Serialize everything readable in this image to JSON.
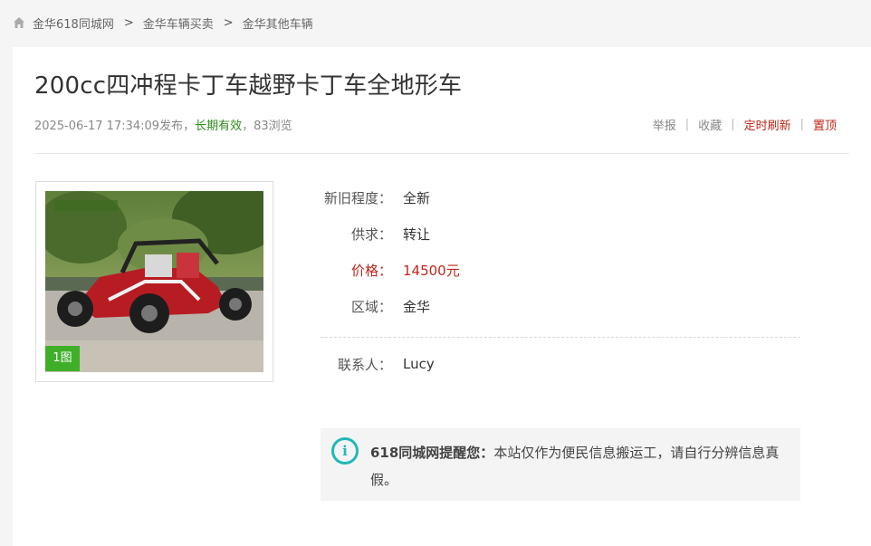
{
  "breadcrumb": {
    "items": [
      {
        "label": "金华618同城网"
      },
      {
        "label": "金华车辆买卖"
      },
      {
        "label": "金华其他车辆"
      }
    ],
    "separator": ">"
  },
  "listing": {
    "title": "200cc四冲程卡丁车越野卡丁车全地形车",
    "published": "2025-06-17 17:34:09发布，",
    "validity": "长期有效",
    "views": "，83浏览"
  },
  "actions": {
    "report": "举报",
    "favorite": "收藏",
    "refresh": "定时刷新",
    "pin": "置顶",
    "separator": "|"
  },
  "gallery": {
    "image_count": "1图"
  },
  "details": {
    "condition": {
      "label": "新旧程度：",
      "value": "全新"
    },
    "supply": {
      "label": "供求：",
      "value": "转让"
    },
    "price": {
      "label": "价格：",
      "value": "14500元"
    },
    "region": {
      "label": "区域：",
      "value": "金华"
    },
    "contact": {
      "label": "联系人：",
      "value": "Lucy"
    }
  },
  "notice": {
    "icon_text": "i",
    "lead": "618同城网提醒您：",
    "text": "本站仅作为便民信息搬运工，请自行分辨信息真假。"
  },
  "colors": {
    "accent_red": "#c0261b",
    "validity_green": "#2e8b1e",
    "badge_green": "#3fae29",
    "notice_teal": "#1fb9b7"
  }
}
